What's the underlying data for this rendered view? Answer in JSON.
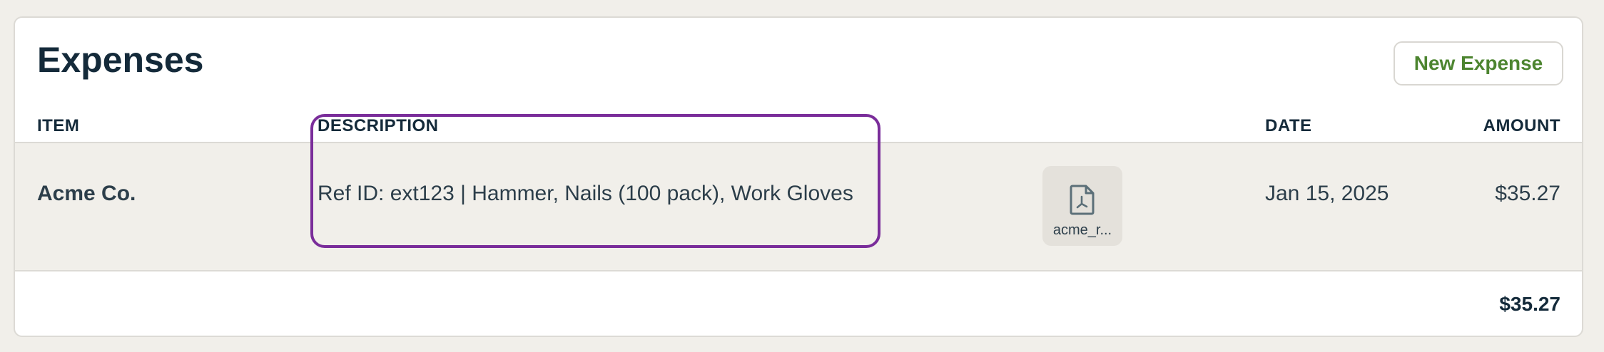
{
  "header": {
    "title": "Expenses",
    "new_expense_label": "New Expense"
  },
  "table": {
    "columns": {
      "item": "ITEM",
      "description": "DESCRIPTION",
      "date": "DATE",
      "amount": "AMOUNT"
    },
    "rows": [
      {
        "item": "Acme Co.",
        "description": "Ref ID: ext123 | Hammer, Nails (100 pack), Work Gloves",
        "attachment": {
          "icon": "pdf-file-icon",
          "filename": "acme_r..."
        },
        "date": "Jan 15, 2025",
        "amount": "$35.27"
      }
    ],
    "total": "$35.27"
  },
  "colors": {
    "accent_green": "#4d8530",
    "highlight_purple": "#7a2d9a",
    "row_background": "#f1efea"
  }
}
